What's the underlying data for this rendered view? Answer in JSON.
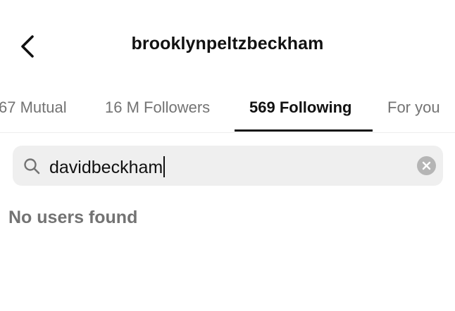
{
  "header": {
    "title": "brooklynpeltzbeckham",
    "back_icon": "chevron-left-icon"
  },
  "tabs": [
    {
      "label": "67 Mutual",
      "active": false
    },
    {
      "label": "16 M Followers",
      "active": false
    },
    {
      "label": "569 Following",
      "active": true
    },
    {
      "label": "For you",
      "active": false
    }
  ],
  "search": {
    "value": "davidbeckham",
    "search_icon": "search-icon",
    "clear_icon": "clear-icon"
  },
  "results": {
    "empty_message": "No users found"
  },
  "colors": {
    "text": "#111111",
    "muted": "#737373",
    "search_bg": "#efefef",
    "clear_bg": "#b5b5b5"
  }
}
